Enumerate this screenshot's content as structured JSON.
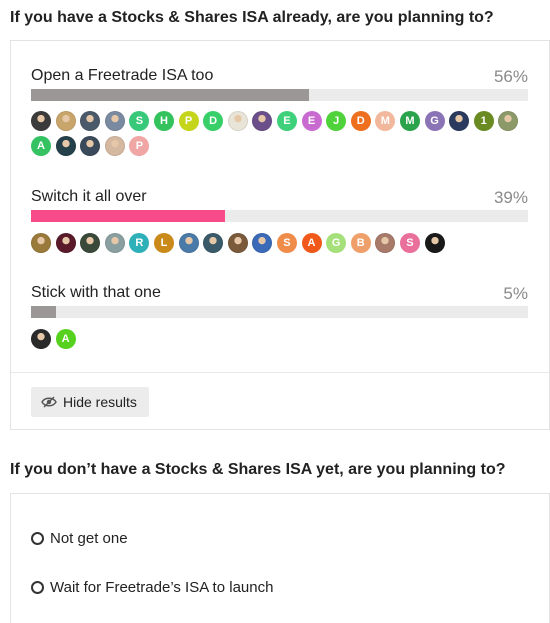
{
  "poll1": {
    "title": "If you have a Stocks & Shares ISA already, are you planning to?",
    "options": [
      {
        "label": "Open a Freetrade ISA too",
        "percent": "56%",
        "fill": 0.56,
        "bar_color": "#9b9797",
        "voters": [
          {
            "type": "photo",
            "color": "#3b3b3b"
          },
          {
            "type": "photo",
            "color": "#c8a56a"
          },
          {
            "type": "photo",
            "color": "#4a5a6a"
          },
          {
            "type": "photo",
            "color": "#7a8aa0"
          },
          {
            "type": "letter",
            "letter": "S",
            "color": "#37c979"
          },
          {
            "type": "letter",
            "letter": "H",
            "color": "#34c25d"
          },
          {
            "type": "letter",
            "letter": "P",
            "color": "#c5d51c"
          },
          {
            "type": "letter",
            "letter": "D",
            "color": "#38cf68"
          },
          {
            "type": "photo",
            "color": "#e8e4d8"
          },
          {
            "type": "photo",
            "color": "#6b4f8a"
          },
          {
            "type": "letter",
            "letter": "E",
            "color": "#3ed07a"
          },
          {
            "type": "letter",
            "letter": "E",
            "color": "#c86ad0"
          },
          {
            "type": "letter",
            "letter": "J",
            "color": "#4fd23a"
          },
          {
            "type": "letter",
            "letter": "D",
            "color": "#ee6f1d"
          },
          {
            "type": "letter",
            "letter": "M",
            "color": "#f2b89e"
          },
          {
            "type": "letter",
            "letter": "M",
            "color": "#2aa34c"
          },
          {
            "type": "letter",
            "letter": "G",
            "color": "#8a74b6"
          },
          {
            "type": "photo",
            "color": "#2a3a5e"
          },
          {
            "type": "letter",
            "letter": "1",
            "color": "#6a8a22"
          },
          {
            "type": "photo",
            "color": "#8c9a6a"
          },
          {
            "type": "letter",
            "letter": "A",
            "color": "#35c263"
          },
          {
            "type": "photo",
            "color": "#24404a"
          },
          {
            "type": "photo",
            "color": "#3a4a5a"
          },
          {
            "type": "photo",
            "color": "#d4b8a0"
          },
          {
            "type": "letter",
            "letter": "P",
            "color": "#f0a6a4"
          }
        ]
      },
      {
        "label": "Switch it all over",
        "percent": "39%",
        "fill": 0.39,
        "bar_color": "#f74b8a",
        "voters": [
          {
            "type": "photo",
            "color": "#9a7a3a"
          },
          {
            "type": "photo",
            "color": "#5a1a2a"
          },
          {
            "type": "photo",
            "color": "#3a4a3a"
          },
          {
            "type": "photo",
            "color": "#8aa0a0"
          },
          {
            "type": "letter",
            "letter": "R",
            "color": "#2eb0b8"
          },
          {
            "type": "letter",
            "letter": "L",
            "color": "#c98a1a"
          },
          {
            "type": "photo",
            "color": "#4a7aa8"
          },
          {
            "type": "photo",
            "color": "#3a5a6a"
          },
          {
            "type": "photo",
            "color": "#7a5a3a"
          },
          {
            "type": "photo",
            "color": "#3a6ab8"
          },
          {
            "type": "letter",
            "letter": "S",
            "color": "#ef8c4a"
          },
          {
            "type": "letter",
            "letter": "A",
            "color": "#f0591a"
          },
          {
            "type": "letter",
            "letter": "G",
            "color": "#a6e07a"
          },
          {
            "type": "letter",
            "letter": "B",
            "color": "#efa06a"
          },
          {
            "type": "photo",
            "color": "#a87a6a"
          },
          {
            "type": "letter",
            "letter": "S",
            "color": "#e8709a"
          },
          {
            "type": "photo",
            "color": "#1a1a1a"
          }
        ]
      },
      {
        "label": "Stick with that one",
        "percent": "5%",
        "fill": 0.05,
        "bar_color": "#9b9797",
        "voters": [
          {
            "type": "photo",
            "color": "#2a2a2a"
          },
          {
            "type": "letter",
            "letter": "A",
            "color": "#56d11e"
          }
        ]
      }
    ],
    "hide_results_label": "Hide results"
  },
  "poll2": {
    "title": "If you don’t have a Stocks & Shares ISA yet, are you planning to?",
    "options": [
      {
        "label": "Not get one"
      },
      {
        "label": "Wait for Freetrade’s ISA to launch"
      }
    ]
  }
}
